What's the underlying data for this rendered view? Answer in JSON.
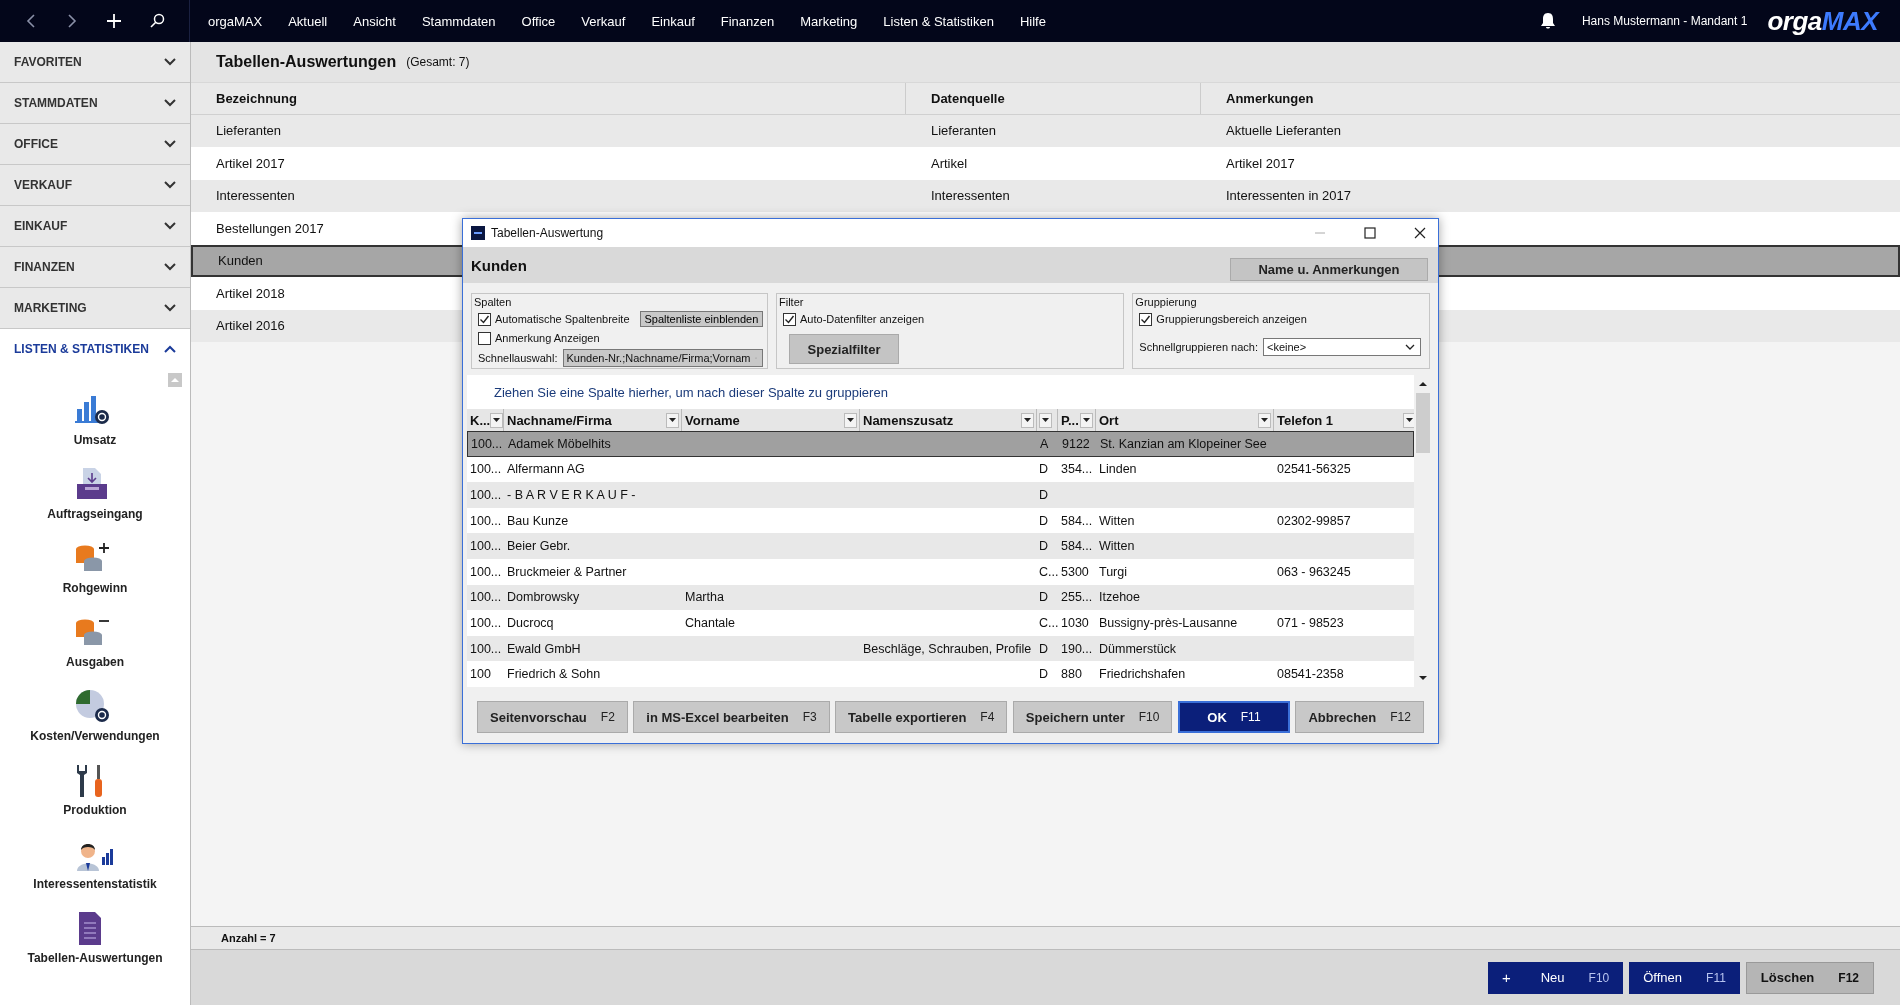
{
  "topbar": {
    "menu": [
      "orgaMAX",
      "Aktuell",
      "Ansicht",
      "Stammdaten",
      "Office",
      "Verkauf",
      "Einkauf",
      "Finanzen",
      "Marketing",
      "Listen & Statistiken",
      "Hilfe"
    ],
    "user": "Hans Mustermann - Mandant 1",
    "logo": {
      "first": "orga",
      "second": "MAX"
    }
  },
  "sidebar": {
    "sections": [
      {
        "label": "FAVORITEN",
        "expanded": false
      },
      {
        "label": "STAMMDATEN",
        "expanded": false
      },
      {
        "label": "OFFICE",
        "expanded": false
      },
      {
        "label": "VERKAUF",
        "expanded": false
      },
      {
        "label": "EINKAUF",
        "expanded": false
      },
      {
        "label": "FINANZEN",
        "expanded": false
      },
      {
        "label": "MARKETING",
        "expanded": false
      },
      {
        "label": "LISTEN & STATISTIKEN",
        "expanded": true
      }
    ],
    "items": [
      {
        "label": "Umsatz",
        "kind": "revenue"
      },
      {
        "label": "Auftragseingang",
        "kind": "inbox"
      },
      {
        "label": "Rohgewinn",
        "kind": "coins-plus"
      },
      {
        "label": "Ausgaben",
        "kind": "coins-minus"
      },
      {
        "label": "Kosten/Verwendungen",
        "kind": "pie"
      },
      {
        "label": "Produktion",
        "kind": "tools"
      },
      {
        "label": "Interessentenstatistik",
        "kind": "person"
      },
      {
        "label": "Tabellen-Auswertungen",
        "kind": "document"
      }
    ]
  },
  "main": {
    "title": "Tabellen-Auswertungen",
    "count": "(Gesamt: 7)",
    "columns": [
      "Bezeichnung",
      "Datenquelle",
      "Anmerkungen"
    ],
    "rows": [
      {
        "cells": [
          "Lieferanten",
          "Lieferanten",
          "Aktuelle Lieferanten"
        ],
        "selected": false
      },
      {
        "cells": [
          "Artikel 2017",
          "Artikel",
          "Artikel 2017"
        ],
        "selected": false
      },
      {
        "cells": [
          "Interessenten",
          "Interessenten",
          "Interessenten in 2017"
        ],
        "selected": false
      },
      {
        "cells": [
          "Bestellungen 2017"
        ],
        "selected": false
      },
      {
        "cells": [
          "Kunden"
        ],
        "selected": true
      },
      {
        "cells": [
          "Artikel 2018"
        ],
        "selected": false
      },
      {
        "cells": [
          "Artikel 2016"
        ],
        "selected": false
      }
    ],
    "status": "Anzahl = 7"
  },
  "actions": [
    {
      "prefix": "+",
      "label": "Neu",
      "key": "F10",
      "kind": "primary"
    },
    {
      "label": "Öffnen",
      "key": "F11",
      "kind": "primary"
    },
    {
      "label": "Löschen",
      "key": "F12",
      "kind": "secondary"
    }
  ],
  "dialog": {
    "title": "Tabellen-Auswertung",
    "heading": "Kunden",
    "name_button": "Name u. Anmerkungen",
    "spalten": {
      "legend": "Spalten",
      "checkboxes": [
        {
          "label": "Automatische Spaltenbreite",
          "checked": true
        },
        {
          "label": "Anmerkung Anzeigen",
          "checked": false
        }
      ],
      "button": "Spaltenliste einblenden",
      "quick_label": "Schnellauswahl:",
      "quick_value": "Kunden-Nr.;Nachname/Firma;Vornam"
    },
    "filter": {
      "legend": "Filter",
      "checkbox": {
        "label": "Auto-Datenfilter anzeigen",
        "checked": true
      },
      "button": "Spezialfilter"
    },
    "gruppierung": {
      "legend": "Gruppierung",
      "checkbox": {
        "label": "Gruppierungsbereich anzeigen",
        "checked": true
      },
      "label": "Schnellgruppieren nach:",
      "value": "<keine>"
    },
    "group_hint": "Ziehen Sie eine Spalte hierher, um nach dieser Spalte zu gruppieren",
    "columns": [
      {
        "label": "K..."
      },
      {
        "label": "Nachname/Firma"
      },
      {
        "label": "Vorname"
      },
      {
        "label": "Namenszusatz"
      },
      {},
      {
        "label": "P..."
      },
      {
        "label": "Ort"
      },
      {
        "label": "Telefon 1"
      }
    ],
    "rows": [
      {
        "cells": [
          "100...",
          "Adamek Möbelhits",
          "",
          "",
          "A",
          "9122",
          "St. Kanzian am Klopeiner See",
          ""
        ],
        "selected": true
      },
      {
        "cells": [
          "100...",
          "Alfermann AG",
          "",
          "",
          "D",
          "354...",
          "Linden",
          "02541-56325"
        ],
        "selected": false
      },
      {
        "cells": [
          "100...",
          "- B A R V E R K A U F -",
          "",
          "",
          "D",
          "",
          "",
          ""
        ],
        "selected": false
      },
      {
        "cells": [
          "100...",
          "Bau Kunze",
          "",
          "",
          "D",
          "584...",
          "Witten",
          "02302-99857"
        ],
        "selected": false
      },
      {
        "cells": [
          "100...",
          "Beier Gebr.",
          "",
          "",
          "D",
          "584...",
          "Witten",
          ""
        ],
        "selected": false
      },
      {
        "cells": [
          "100...",
          "Bruckmeier & Partner",
          "",
          "",
          "C...",
          "5300",
          "Turgi",
          "063 - 963245"
        ],
        "selected": false
      },
      {
        "cells": [
          "100...",
          "Dombrowsky",
          "Martha",
          "",
          "D",
          "255...",
          "Itzehoe",
          ""
        ],
        "selected": false
      },
      {
        "cells": [
          "100...",
          "Ducrocq",
          "Chantale",
          "",
          "C...",
          "1030",
          "Bussigny-près-Lausanne",
          "071 - 98523"
        ],
        "selected": false
      },
      {
        "cells": [
          "100...",
          "Ewald GmbH",
          "",
          "Beschläge, Schrauben, Profile",
          "D",
          "190...",
          "Dümmerstück",
          ""
        ],
        "selected": false
      },
      {
        "cells": [
          "100",
          "Friedrich & Sohn",
          "",
          "",
          "D",
          "880",
          "Friedrichshafen",
          "08541-2358"
        ],
        "selected": false
      }
    ],
    "buttons": [
      {
        "label": "Seitenvorschau",
        "key": "F2",
        "kind": "normal"
      },
      {
        "label": "in MS-Excel bearbeiten",
        "key": "F3",
        "kind": "normal"
      },
      {
        "label": "Tabelle exportieren",
        "key": "F4",
        "kind": "normal"
      },
      {
        "label": "Speichern unter",
        "key": "F10",
        "kind": "normal"
      },
      {
        "label": "OK",
        "key": "F11",
        "kind": "default"
      },
      {
        "label": "Abbrechen",
        "key": "F12",
        "kind": "normal"
      }
    ]
  }
}
